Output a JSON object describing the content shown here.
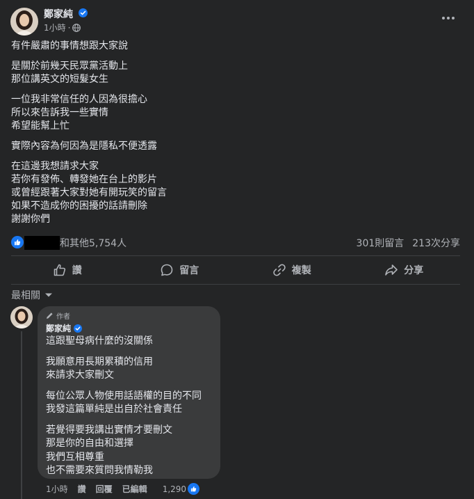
{
  "post": {
    "author": "鄭家純",
    "time": "1小時",
    "audience_icon": "globe-icon",
    "paragraphs": [
      [
        "有件嚴肅的事情想跟大家說"
      ],
      [
        "是關於前幾天民眾黨活動上",
        "那位講英文的短髮女生"
      ],
      [
        "一位我非常信任的人因為很擔心",
        "所以來告訴我一些實情",
        "希望能幫上忙"
      ],
      [
        "實際內容為何因為是隱私不便透露"
      ],
      [
        "在這邊我想請求大家",
        "若你有發佈、轉發她在台上的影片",
        "或曾經跟著大家對她有開玩笑的留言",
        "如果不造成你的困擾的話請刪除",
        "謝謝你們"
      ]
    ]
  },
  "reactions": {
    "reactor_text": "和其他5,754人",
    "comments_count": "301則留言",
    "shares_count": "213次分享"
  },
  "actions": {
    "like": "讚",
    "comment": "留言",
    "copy": "複製",
    "share": "分享"
  },
  "sort": {
    "label": "最相關"
  },
  "comment": {
    "author_tag": "作者",
    "author": "鄭家純",
    "paragraphs": [
      [
        "這跟聖母病什麼的沒關係"
      ],
      [
        "我願意用長期累積的信用",
        "來請求大家刪文"
      ],
      [
        "每位公眾人物使用話語權的目的不同",
        "我發這篇單純是出自於社會責任"
      ],
      [
        "若覺得要我講出實情才要刪文",
        "那是你的自由和選擇",
        "我們互相尊重",
        "也不需要來質問我情勒我"
      ]
    ],
    "time": "1小時",
    "like": "讚",
    "reply": "回覆",
    "edited": "已編輯",
    "reaction_count": "1,290"
  },
  "colors": {
    "background": "#242526",
    "bubble": "#3a3b3c",
    "accent": "#1877f2",
    "text_primary": "#e4e6eb",
    "text_secondary": "#b0b3b8"
  }
}
